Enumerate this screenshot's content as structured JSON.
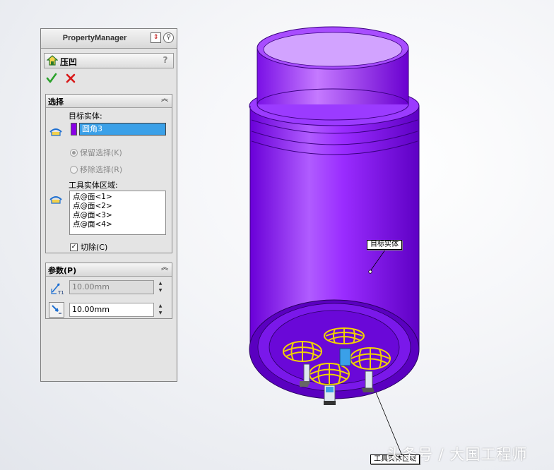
{
  "property_manager": {
    "title": "PropertyManager",
    "feature_name": "压凹",
    "help_label": "?",
    "sections": {
      "selection": {
        "title": "选择",
        "target_body_label": "目标实体:",
        "target_body_value": "圆角3",
        "keep_selection_label": "保留选择(K)",
        "remove_selection_label": "移除选择(R)",
        "tool_region_label": "工具实体区域:",
        "tool_region_items": [
          "点@面<1>",
          "点@面<2>",
          "点@面<3>",
          "点@面<4>"
        ],
        "cut_label": "切除(C)",
        "cut_checked": true,
        "keep_selected": true
      },
      "parameters": {
        "title": "参数(P)",
        "thickness_value": "10.00mm",
        "clearance_value": "10.00mm"
      }
    }
  },
  "viewport": {
    "target_callout": "目标实体",
    "tool_callout": "工具实体区域"
  },
  "watermark": "头条号 / 大国工程师",
  "colors": {
    "body_purple": "#8a00ff",
    "tool_yellow": "#f2d200",
    "selection_blue": "#3aa0e8",
    "ok_green": "#2aa12a",
    "cancel_red": "#d81818"
  }
}
